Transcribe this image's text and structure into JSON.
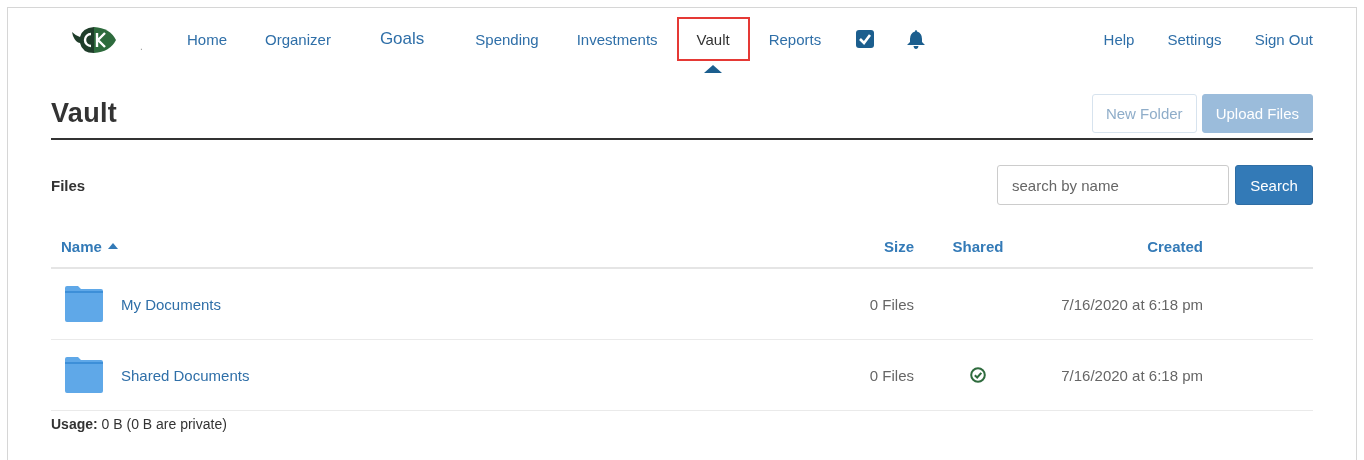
{
  "header": {
    "logo_caption": ".",
    "nav": [
      {
        "label": "Home",
        "selected": false
      },
      {
        "label": "Organizer",
        "selected": false
      },
      {
        "label": "Goals",
        "selected": false
      },
      {
        "label": "Spending",
        "selected": false
      },
      {
        "label": "Investments",
        "selected": false
      },
      {
        "label": "Vault",
        "selected": true
      },
      {
        "label": "Reports",
        "selected": false
      }
    ],
    "right_links": [
      "Help",
      "Settings",
      "Sign Out"
    ]
  },
  "page": {
    "title": "Vault",
    "buttons": [
      {
        "label": "New Folder",
        "kind": "outline",
        "disabled": true
      },
      {
        "label": "Upload Files",
        "kind": "primary",
        "disabled": true
      }
    ]
  },
  "files": {
    "heading": "Files",
    "search": {
      "placeholder": "search by name",
      "button": "Search"
    },
    "columns": [
      {
        "label": "Name",
        "sorted": true
      },
      {
        "label": "Size",
        "sorted": false
      },
      {
        "label": "Shared",
        "sorted": false
      },
      {
        "label": "Created",
        "sorted": false
      }
    ],
    "rows": [
      {
        "name": "My Documents",
        "size": "0 Files",
        "shared": false,
        "created": "7/16/2020 at 6:18 pm"
      },
      {
        "name": "Shared Documents",
        "size": "0 Files",
        "shared": true,
        "created": "7/16/2020 at 6:18 pm"
      }
    ],
    "usage": "**Usage:** 0 B (0 B are private)"
  }
}
